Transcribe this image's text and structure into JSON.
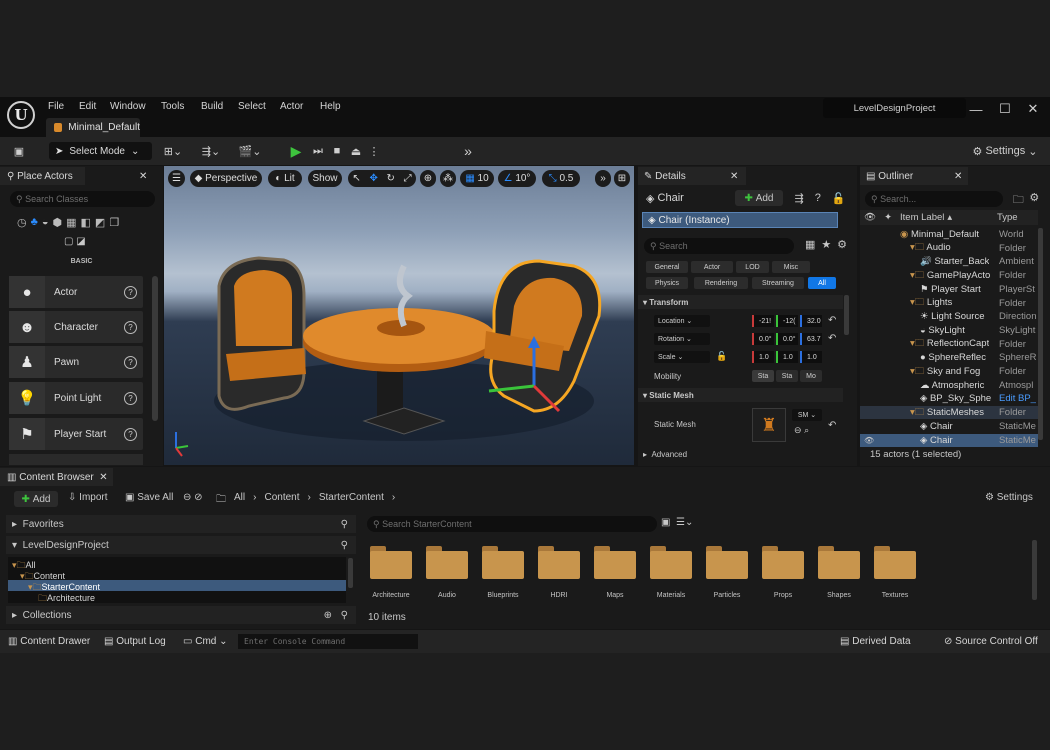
{
  "app": {
    "project": "LevelDesignProject",
    "level_tab": "Minimal_Default"
  },
  "menu": [
    "File",
    "Edit",
    "Window",
    "Tools",
    "Build",
    "Select",
    "Actor",
    "Help"
  ],
  "toolbar": {
    "select_mode": "Select Mode",
    "settings": "Settings"
  },
  "place_actors": {
    "title": "Place Actors",
    "search_placeholder": "Search Classes",
    "category": "BASIC",
    "items": [
      "Actor",
      "Character",
      "Pawn",
      "Point Light",
      "Player Start"
    ]
  },
  "viewport": {
    "perspective": "Perspective",
    "lit": "Lit",
    "show": "Show",
    "grid": "10",
    "angle": "10°",
    "scale": "0.5"
  },
  "details": {
    "title": "Details",
    "object": "Chair",
    "add": "Add",
    "instance": "Chair (Instance)",
    "search_placeholder": "Search",
    "filters": [
      "General",
      "Actor",
      "LOD",
      "Misc",
      "Physics",
      "Rendering",
      "Streaming",
      "All"
    ],
    "transform": "Transform",
    "location": "Location",
    "rotation": "Rotation",
    "scale": "Scale",
    "mobility": "Mobility",
    "loc": [
      "-21!",
      "-12(",
      "32.0"
    ],
    "rot": [
      "0.0°",
      "0.0°",
      "63.7"
    ],
    "scl": [
      "1.0",
      "1.0",
      "1.0"
    ],
    "mobility_opts": [
      "Sta",
      "Sta",
      "Mo"
    ],
    "static_mesh_section": "Static Mesh",
    "static_mesh_label": "Static Mesh",
    "sm_dropdown": "SM",
    "advanced": "Advanced"
  },
  "outliner": {
    "title": "Outliner",
    "search_placeholder": "Search...",
    "col_label": "Item Label",
    "col_type": "Type",
    "rows": [
      {
        "label": "Minimal_Default",
        "type": "World",
        "indent": 0,
        "icon": "world"
      },
      {
        "label": "Audio",
        "type": "Folder",
        "indent": 1,
        "icon": "folder"
      },
      {
        "label": "Starter_Back",
        "type": "Ambient",
        "indent": 2,
        "icon": "speaker"
      },
      {
        "label": "GamePlayActo",
        "type": "Folder",
        "indent": 1,
        "icon": "folder"
      },
      {
        "label": "Player Start",
        "type": "PlayerSt",
        "indent": 2,
        "icon": "flag"
      },
      {
        "label": "Lights",
        "type": "Folder",
        "indent": 1,
        "icon": "folder"
      },
      {
        "label": "Light Source",
        "type": "Direction",
        "indent": 2,
        "icon": "sun"
      },
      {
        "label": "SkyLight",
        "type": "SkyLight",
        "indent": 2,
        "icon": "sky"
      },
      {
        "label": "ReflectionCapt",
        "type": "Folder",
        "indent": 1,
        "icon": "folder"
      },
      {
        "label": "SphereReflec",
        "type": "SphereR",
        "indent": 2,
        "icon": "sphere"
      },
      {
        "label": "Sky and Fog",
        "type": "Folder",
        "indent": 1,
        "icon": "folder"
      },
      {
        "label": "Atmospheric",
        "type": "Atmospl",
        "indent": 2,
        "icon": "cloud"
      },
      {
        "label": "BP_Sky_Sphe",
        "type": "Edit BP_",
        "indent": 2,
        "icon": "bp"
      },
      {
        "label": "StaticMeshes",
        "type": "Folder",
        "indent": 1,
        "icon": "folder"
      },
      {
        "label": "Chair",
        "type": "StaticMe",
        "indent": 2,
        "icon": "mesh"
      },
      {
        "label": "Chair",
        "type": "StaticMe",
        "indent": 2,
        "icon": "mesh"
      }
    ],
    "status": "15 actors (1 selected)"
  },
  "content_browser": {
    "title": "Content Browser",
    "add": "Add",
    "import": "Import",
    "save_all": "Save All",
    "path": [
      "All",
      "Content",
      "StarterContent"
    ],
    "settings": "Settings",
    "favorites": "Favorites",
    "project": "LevelDesignProject",
    "collections": "Collections",
    "tree": [
      "All",
      "Content",
      "StarterContent",
      "Architecture"
    ],
    "search_placeholder": "Search StarterContent",
    "folders": [
      "Architecture",
      "Audio",
      "Blueprints",
      "HDRI",
      "Maps",
      "Materials",
      "Particles",
      "Props",
      "Shapes",
      "Textures"
    ],
    "count": "10 items"
  },
  "status": {
    "content_drawer": "Content Drawer",
    "output_log": "Output Log",
    "cmd": "Cmd",
    "console_placeholder": "Enter Console Command",
    "derived": "Derived Data",
    "source_control": "Source Control Off"
  },
  "colors": {
    "accent": "#1177e6",
    "selection": "#3d5a7d",
    "folder": "#c8954d",
    "chair": "#d07a1f"
  }
}
